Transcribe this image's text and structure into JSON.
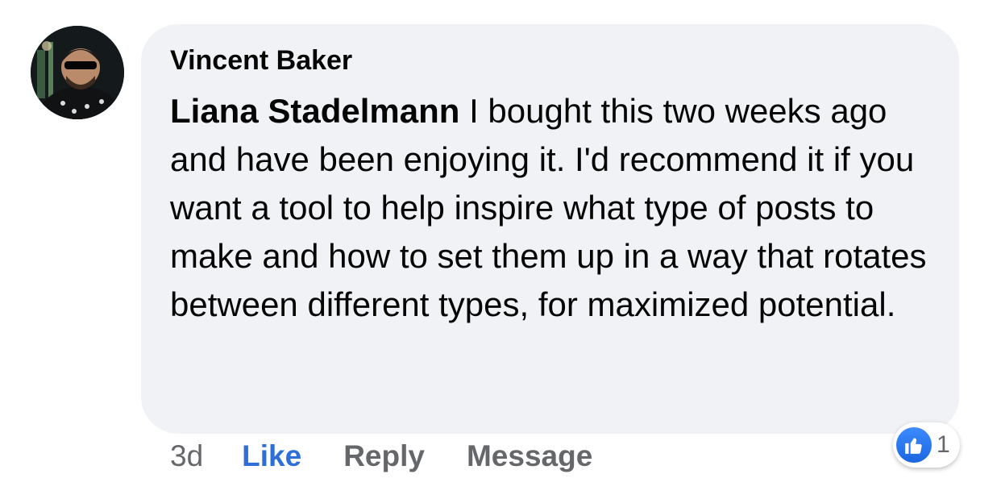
{
  "comment": {
    "author": "Vincent Baker",
    "mention": "Liana Stadelmann",
    "text": "I bought this two weeks ago and have been enjoying it. I'd recommend it if you want a tool to help inspire what type of posts to make and how to set them up in a way that rotates between different types, for maximized potential.",
    "time": "3d"
  },
  "actions": {
    "like_label": "Like",
    "reply_label": "Reply",
    "message_label": "Message"
  },
  "reactions": {
    "icon": "thumbs-up-icon",
    "count": "1"
  },
  "colors": {
    "bubble": "#f0f2f5",
    "like_accent": "#2d6fd6",
    "muted": "#65676b"
  }
}
